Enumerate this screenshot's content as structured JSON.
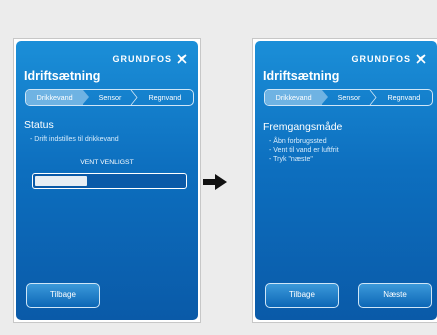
{
  "brand": "GRUNDFOS",
  "colors": {
    "screen_top": "#1b8fd8",
    "screen_bottom": "#0a5aa8",
    "step_active": "#6fb3e3"
  },
  "screens": [
    {
      "title": "Idriftsætning",
      "steps": [
        "Drikkevand",
        "Sensor",
        "Regnvand"
      ],
      "active_step": 0,
      "section": "Status",
      "lines": [
        "- Drift indstilles til drikkevand"
      ],
      "wait_text": "VENT VENLIGST",
      "progress": 0.35,
      "buttons": [
        "Tilbage"
      ]
    },
    {
      "title": "Idriftsætning",
      "steps": [
        "Drikkevand",
        "Sensor",
        "Regnvand"
      ],
      "active_step": 0,
      "section": "Fremgangsmåde",
      "lines": [
        "- Åbn forbrugssted",
        "- Vent til vand er luftfrit",
        "- Tryk \"næste\""
      ],
      "buttons": [
        "Tilbage",
        "Næste"
      ]
    }
  ],
  "arrow_icon": "arrow-right-icon"
}
